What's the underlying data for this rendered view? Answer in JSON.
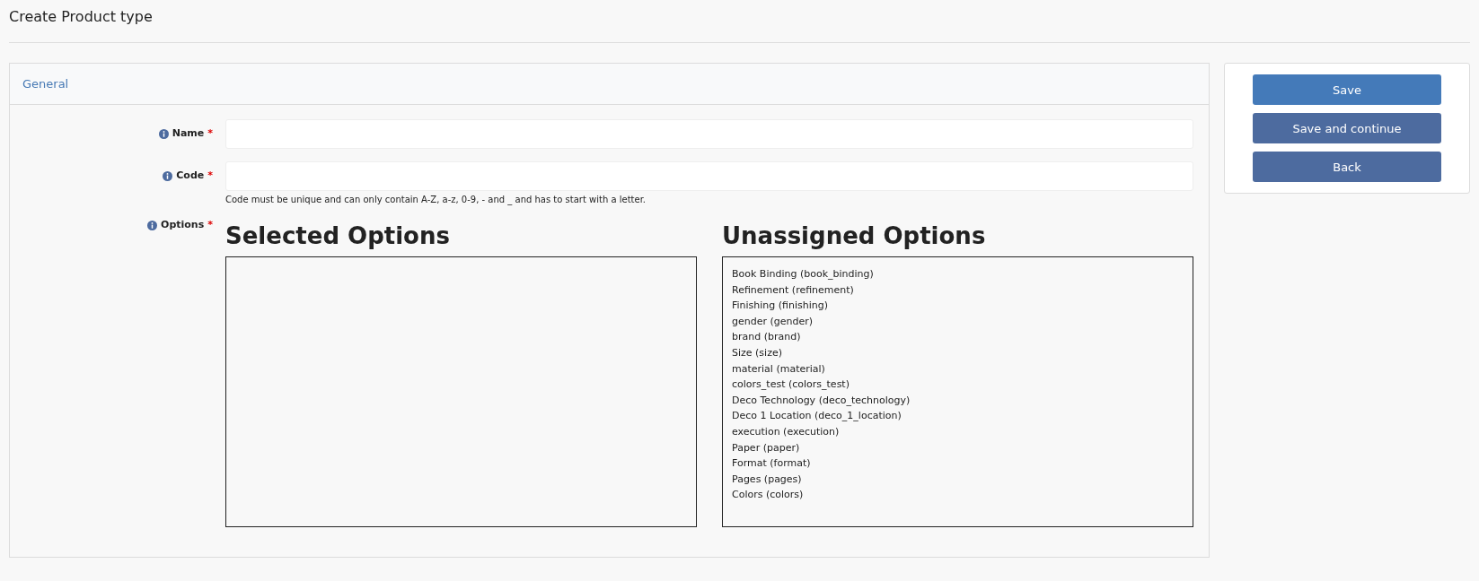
{
  "page_title": "Create Product type",
  "panel": {
    "heading": "General",
    "fields": [
      {
        "label": "Name",
        "required_mark": "*"
      },
      {
        "label": "Code",
        "required_mark": "*",
        "help": "Code must be unique and can only contain A-Z, a-z, 0-9, - and _ and has to start with a letter."
      }
    ],
    "options": {
      "label": "Options",
      "required_mark": "*",
      "lists": [
        {
          "heading": "Selected Options"
        },
        {
          "heading": "Unassigned Options",
          "items": [
            "Book Binding (book_binding)",
            "Refinement (refinement)",
            "Finishing (finishing)",
            "gender (gender)",
            "brand (brand)",
            "Size (size)",
            "material (material)",
            "colors_test (colors_test)",
            "Deco Technology (deco_technology)",
            "Deco 1 Location (deco_1_location)",
            "execution (execution)",
            "Paper (paper)",
            "Format (format)",
            "Pages (pages)",
            "Colors (colors)"
          ]
        }
      ]
    }
  },
  "actions": [
    {
      "label": "Save",
      "kind": "primary"
    },
    {
      "label": "Save and continue",
      "kind": "secondary"
    },
    {
      "label": "Back",
      "kind": "secondary"
    }
  ]
}
